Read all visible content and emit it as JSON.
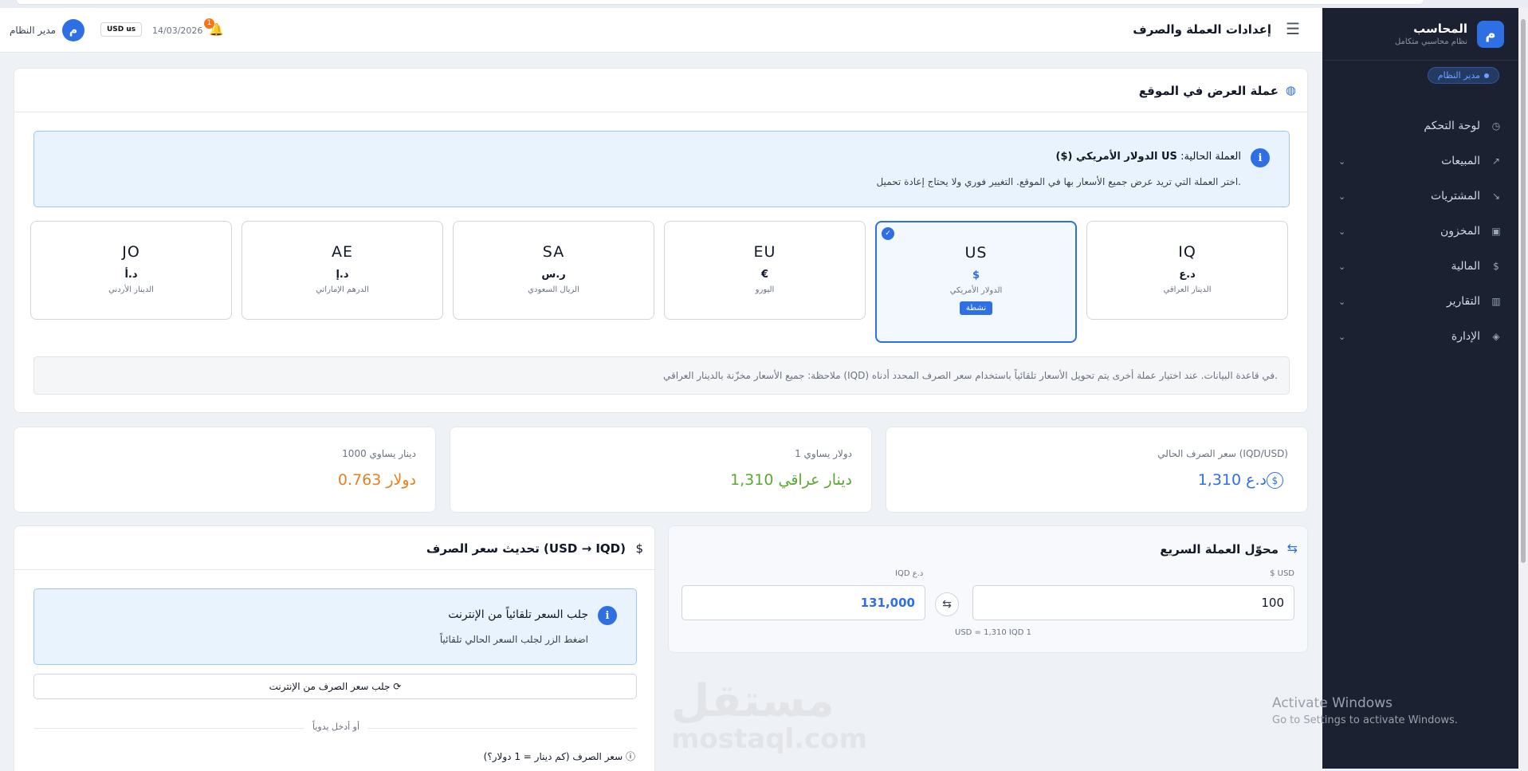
{
  "sidebar": {
    "logo_letter": "م",
    "title": "المحاسب",
    "subtitle": "نظام محاسبي متكامل",
    "role": "مدير النظام",
    "items": [
      {
        "label": "لوحة التحكم",
        "icon": "◷",
        "icon_name": "dashboard-icon",
        "chevron": ""
      },
      {
        "label": "المبيعات",
        "icon": "↗",
        "icon_name": "trend-up-icon",
        "chevron": "⌄"
      },
      {
        "label": "المشتريات",
        "icon": "↘",
        "icon_name": "trend-down-icon",
        "chevron": "⌄"
      },
      {
        "label": "المخزون",
        "icon": "▣",
        "icon_name": "box-icon",
        "chevron": "⌄"
      },
      {
        "label": "المالية",
        "icon": "$",
        "icon_name": "dollar-icon",
        "chevron": "⌄"
      },
      {
        "label": "التقارير",
        "icon": "▥",
        "icon_name": "chart-icon",
        "chevron": "⌄"
      },
      {
        "label": "الإدارة",
        "icon": "◈",
        "icon_name": "shield-icon",
        "chevron": "⌄"
      }
    ]
  },
  "header": {
    "title": "إعدادات العملة والصرف",
    "user_name": "مدير النظام",
    "avatar_letter": "م",
    "currency_chip": "USD us",
    "date": "14/03/2026",
    "notification_count": "1"
  },
  "display": {
    "title": "عملة العرض في الموقع",
    "current_label": "العملة الحالية:",
    "current_value": "US الدولار الأمريكي ($)",
    "hint": "اختر العملة التي تريد عرض جميع الأسعار بها في الموقع. التغيير فوري ولا يحتاج إعادة تحميل.",
    "active_tag": "نشطة",
    "note": "ملاحظة: جميع الأسعار مخزّنة بالدينار العراقي (IQD) في قاعدة البيانات. عند اختيار عملة أخرى يتم تحويل الأسعار تلقائياً باستخدام سعر الصرف المحدد أدناه.",
    "currencies": [
      {
        "code": "IQ",
        "symbol": "د.ع",
        "name": "الدينار العراقي"
      },
      {
        "code": "US",
        "symbol": "$",
        "name": "الدولار الأمريكي"
      },
      {
        "code": "EU",
        "symbol": "€",
        "name": "اليورو"
      },
      {
        "code": "SA",
        "symbol": "ر.س",
        "name": "الريال السعودي"
      },
      {
        "code": "AE",
        "symbol": "د.إ",
        "name": "الدرهم الإماراتي"
      },
      {
        "code": "JO",
        "symbol": "د.أ",
        "name": "الدينار الأردني"
      }
    ]
  },
  "stats": {
    "current_rate_label": "سعر الصرف الحالي (IQD/USD)",
    "current_rate_value": "1,310 د.ع",
    "one_dollar_label": "1 دولار يساوي",
    "one_dollar_value": "1,310 دينار عراقي",
    "thousand_dinar_label": "1000 دينار يساوي",
    "thousand_dinar_value": "0.763 دولار"
  },
  "update": {
    "title": "تحديث سعر الصرف (USD → IQD)",
    "info_title": "جلب السعر تلقائياً من الإنترنت",
    "info_hint": "اضغط الزر لجلب السعر الحالي تلقائياً",
    "fetch_button": "جلب سعر الصرف من الإنترنت",
    "manual_divider": "أو أدخل يدوياً",
    "rate_label": "سعر الصرف (كم دينار = 1 دولار؟)"
  },
  "converter": {
    "title": "محوّل العملة السريع",
    "usd_label": "$ USD",
    "usd_value": "100",
    "iqd_label": "IQD د.ع",
    "iqd_value": "131,000",
    "rate_hint": "USD = 1,310 IQD 1"
  },
  "watermark": {
    "line1": "مستقل",
    "line2": "mostaql.com"
  },
  "os_overlay": {
    "line1": "Activate Windows",
    "line2": "Go to Settings to activate Windows."
  },
  "colors": {
    "accent": "#2f6fe4",
    "success": "#5aa832",
    "warning": "#e8801f",
    "sidebar_bg": "#1b2130"
  }
}
